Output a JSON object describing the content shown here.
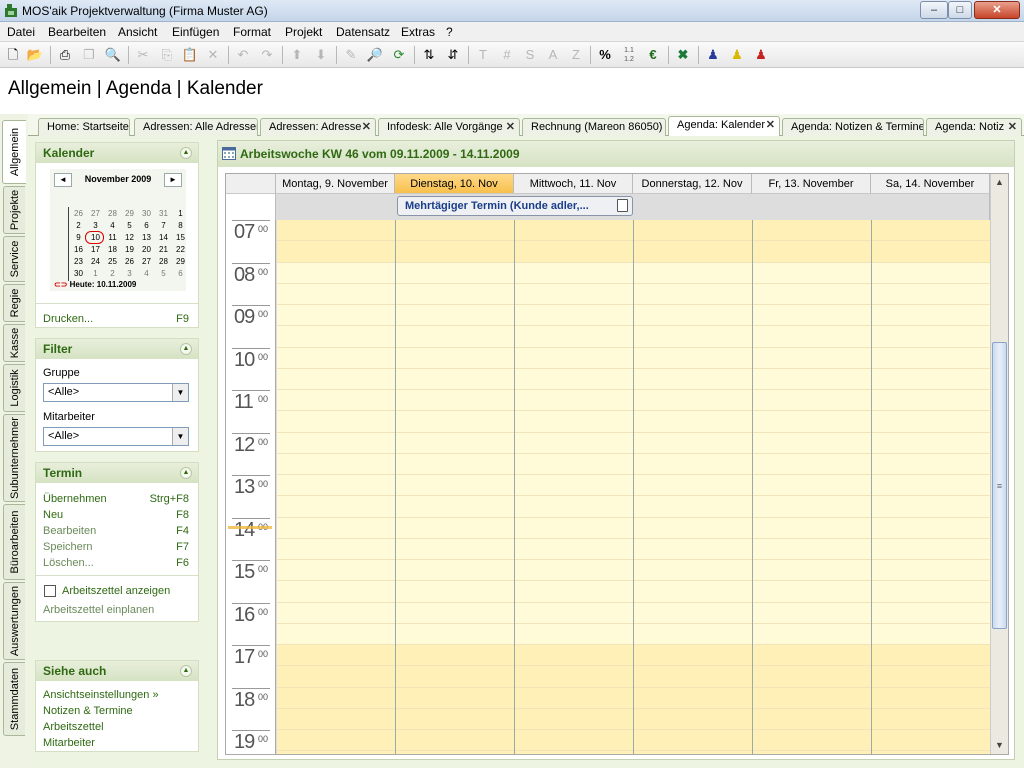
{
  "window": {
    "title": "MOS'aik Projektverwaltung (Firma Muster AG)",
    "minimize": "–",
    "maximize": "□",
    "close": "✕"
  },
  "menu": [
    "Datei",
    "Bearbeiten",
    "Ansicht",
    "Einfügen",
    "Format",
    "Projekt",
    "Datensatz",
    "Extras",
    "?"
  ],
  "header": {
    "title": "Allgemein | Agenda | Kalender"
  },
  "vnav": [
    "Allgemein",
    "Projekte",
    "Service",
    "Regie",
    "Kasse",
    "Logistik",
    "Subunternehmer",
    "Büroarbeiten",
    "Auswertungen",
    "Stammdaten"
  ],
  "tabs": [
    {
      "label": "Home: Startseite",
      "close": false
    },
    {
      "label": "Adressen: Alle Adressen",
      "close": false
    },
    {
      "label": "Adressen: Adresse",
      "close": true
    },
    {
      "label": "Infodesk: Alle Vorgänge",
      "close": true
    },
    {
      "label": "Rechnung (Mareon 86050)",
      "close": false
    },
    {
      "label": "Agenda: Kalender",
      "close": true,
      "active": true
    },
    {
      "label": "Agenda: Notizen & Termine",
      "close": false
    },
    {
      "label": "Agenda: Notiz",
      "close": true
    }
  ],
  "close_glyph": "✕",
  "sidebar": {
    "kalender": {
      "title": "Kalender",
      "month": "November 2009",
      "prev": "◄",
      "next": "►",
      "weeks": [
        [
          "26",
          "27",
          "28",
          "29",
          "30",
          "31",
          "1"
        ],
        [
          "2",
          "3",
          "4",
          "5",
          "6",
          "7",
          "8"
        ],
        [
          "9",
          "10",
          "11",
          "12",
          "13",
          "14",
          "15"
        ],
        [
          "16",
          "17",
          "18",
          "19",
          "20",
          "21",
          "22"
        ],
        [
          "23",
          "24",
          "25",
          "26",
          "27",
          "28",
          "29"
        ],
        [
          "30",
          "1",
          "2",
          "3",
          "4",
          "5",
          "6"
        ]
      ],
      "today_label": "Heute: 10.11.2009",
      "print_label": "Drucken...",
      "print_key": "F9"
    },
    "filter": {
      "title": "Filter",
      "group_label": "Gruppe",
      "group_value": "<Alle>",
      "staff_label": "Mitarbeiter",
      "staff_value": "<Alle>"
    },
    "termin": {
      "title": "Termin",
      "items": [
        {
          "label": "Übernehmen",
          "key": "Strg+F8"
        },
        {
          "label": "Neu",
          "key": "F8"
        },
        {
          "label": "Bearbeiten",
          "key": "F4"
        },
        {
          "label": "Speichern",
          "key": "F7"
        },
        {
          "label": "Löschen...",
          "key": "F6"
        }
      ],
      "checkbox_label": "Arbeitszettel anzeigen",
      "plan_label": "Arbeitszettel einplanen"
    },
    "siehe": {
      "title": "Siehe auch",
      "items": [
        "Ansichtseinstellungen »",
        "Notizen & Termine",
        "Arbeitszettel",
        "Mitarbeiter"
      ]
    }
  },
  "calendar": {
    "title": "Arbeitswoche KW 46 vom 09.11.2009 - 14.11.2009",
    "days": [
      "Montag, 9. November",
      "Dienstag, 10. Nov",
      "Mittwoch, 11. Nov",
      "Donnerstag, 12. Nov",
      "Fr, 13. November",
      "Sa, 14. November"
    ],
    "hours": [
      "07",
      "08",
      "09",
      "10",
      "11",
      "12",
      "13",
      "14",
      "15",
      "16",
      "17",
      "18",
      "19"
    ],
    "minutes": "00",
    "event": "Mehrtägiger Termin (Kunde adler,..."
  },
  "colors": {
    "accent_green": "#2f6a12",
    "workday": "#fffbd8",
    "offhours": "#fff0b8",
    "today_header": "#f8c04c"
  }
}
